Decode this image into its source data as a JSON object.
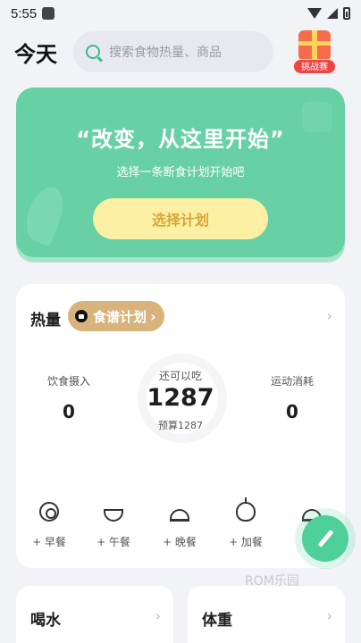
{
  "status_bar": {
    "time": "5:55"
  },
  "header": {
    "title": "今天",
    "search_placeholder": "搜索食物热量、商品",
    "challenge_label": "挑战赛"
  },
  "plan_card": {
    "slogan": "“改变，从这里开始”",
    "subtitle": "选择一条断食计划开始吧",
    "button_label": "选择计划"
  },
  "calorie_card": {
    "title": "热量",
    "recipe_label": "食谱计划",
    "intake_label": "饮食摄入",
    "intake_value": "0",
    "remaining_label": "还可以吃",
    "remaining_value": "1287",
    "budget_text": "预算1287",
    "burn_label": "运动消耗",
    "burn_value": "0",
    "meals": [
      {
        "label": "+ 早餐",
        "icon": "plate-icon"
      },
      {
        "label": "+ 午餐",
        "icon": "bowl-icon"
      },
      {
        "label": "+ 晚餐",
        "icon": "dome-icon"
      },
      {
        "label": "+ 加餐",
        "icon": "apple-icon"
      },
      {
        "label": "+",
        "icon": "more-icon"
      }
    ]
  },
  "cards": {
    "water_title": "喝水",
    "weight_title": "体重"
  },
  "watermark": "ROM乐园",
  "colors": {
    "accent": "#4fcf9a",
    "plan_bg": "#67d0a5",
    "pill": "#d8b37b",
    "button": "#fbf0a3"
  }
}
